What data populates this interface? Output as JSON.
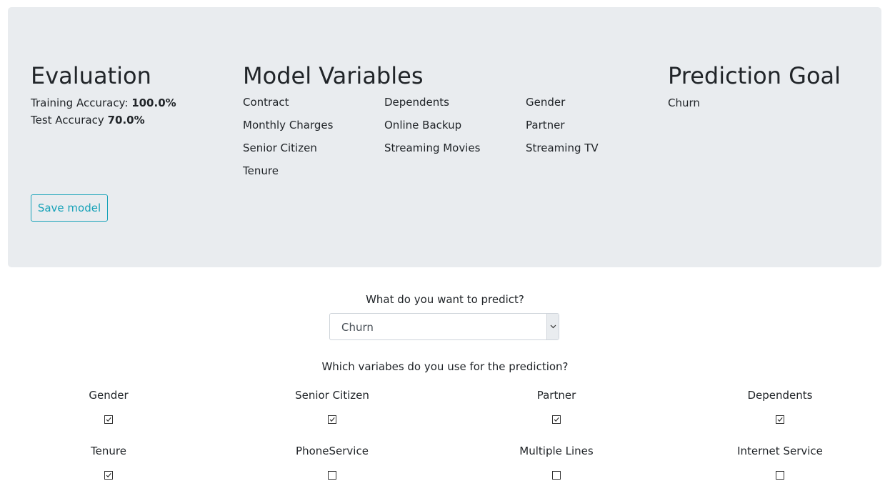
{
  "evaluation": {
    "title": "Evaluation",
    "training_label": "Training Accuracy:",
    "training_value": "100.0%",
    "test_label": "Test Accuracy",
    "test_value": "70.0%",
    "save_label": "Save model"
  },
  "model_variables": {
    "title": "Model Variables",
    "items": [
      "Contract",
      "Dependents",
      "Gender",
      "Monthly Charges",
      "Online Backup",
      "Partner",
      "Senior Citizen",
      "Streaming Movies",
      "Streaming TV",
      "Tenure"
    ]
  },
  "prediction_goal": {
    "title": "Prediction Goal",
    "value": "Churn"
  },
  "predict": {
    "question": "What do you want to predict?",
    "selected": "Churn"
  },
  "variables": {
    "question": "Which variabes do you use for the prediction?",
    "items": [
      {
        "label": "Gender",
        "checked": true
      },
      {
        "label": "Senior Citizen",
        "checked": true
      },
      {
        "label": "Partner",
        "checked": true
      },
      {
        "label": "Dependents",
        "checked": true
      },
      {
        "label": "Tenure",
        "checked": true
      },
      {
        "label": "PhoneService",
        "checked": false
      },
      {
        "label": "Multiple Lines",
        "checked": false
      },
      {
        "label": "Internet Service",
        "checked": false
      }
    ]
  },
  "colors": {
    "accent": "#17a2b8",
    "panel_bg": "#e9ecef"
  }
}
